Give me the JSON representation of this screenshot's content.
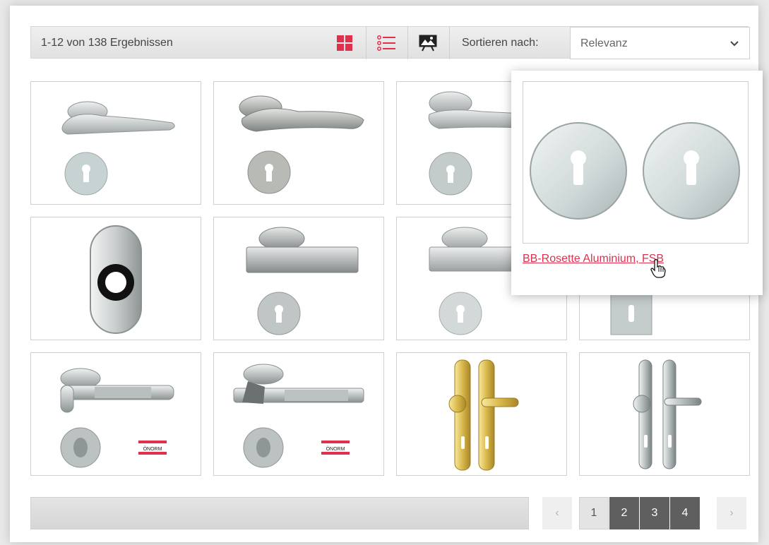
{
  "toolbar": {
    "result_count": "1-12 von 138 Ergebnissen",
    "view_grid_icon": "grid-view-icon",
    "view_list_icon": "list-view-icon",
    "view_image_icon": "image-view-icon",
    "sort_label": "Sortieren nach:",
    "sort_value": "Relevanz",
    "accent_color": "#e0304e"
  },
  "products": [
    {
      "type": "lever-handle",
      "badge": ""
    },
    {
      "type": "lever-handle",
      "badge": ""
    },
    {
      "type": "lever-handle",
      "badge": ""
    },
    {
      "type": "lever-handle",
      "badge": ""
    },
    {
      "type": "oval-rosette",
      "badge": ""
    },
    {
      "type": "square-lever-handle",
      "badge": ""
    },
    {
      "type": "lever-handle",
      "badge": ""
    },
    {
      "type": "square-rosette",
      "badge": ""
    },
    {
      "type": "knurled-lever-handle",
      "badge": "ÖNORM"
    },
    {
      "type": "knurled-lever-handle",
      "badge": "ÖNORM"
    },
    {
      "type": "brass-long-plate",
      "badge": ""
    },
    {
      "type": "chrome-long-plate",
      "badge": ""
    }
  ],
  "popup": {
    "title": "BB-Rosette Aluminium, FSB"
  },
  "pagination": {
    "prev": "‹",
    "pages": [
      "1",
      "2",
      "3",
      "4"
    ],
    "current": "1",
    "next": "›"
  }
}
